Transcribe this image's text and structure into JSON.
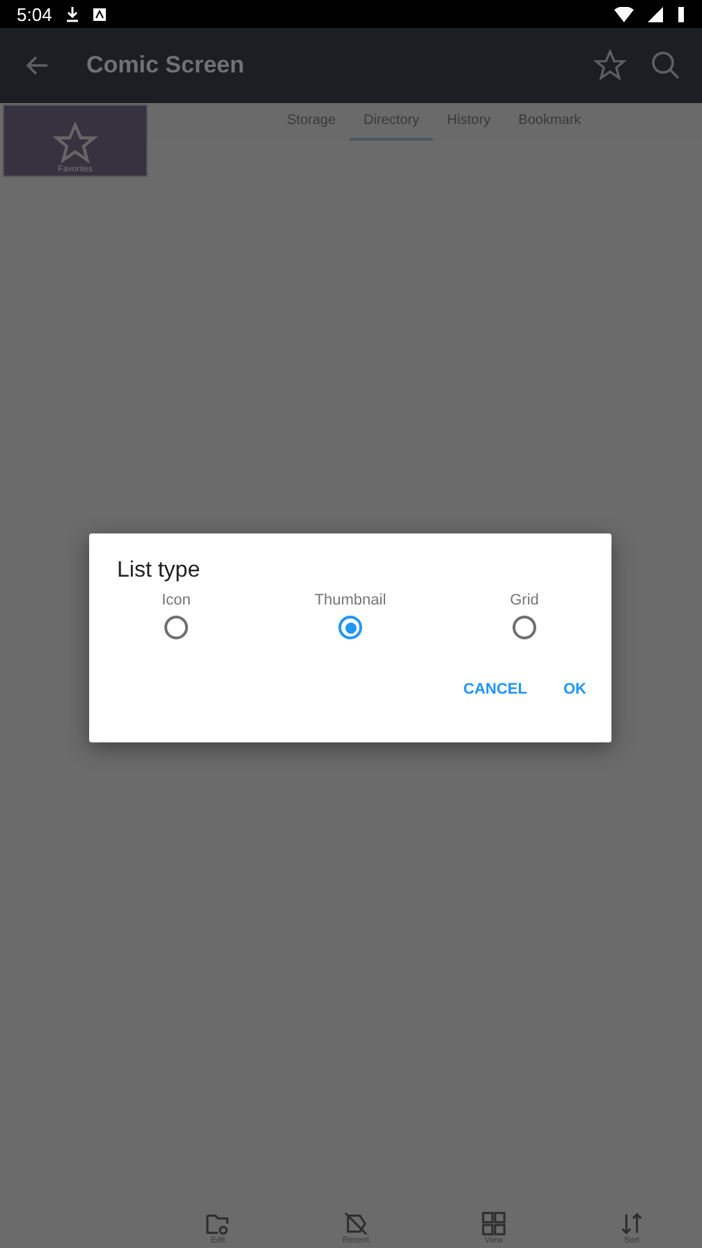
{
  "status_bar": {
    "time": "5:04"
  },
  "app_bar": {
    "title": "Comic Screen"
  },
  "tabs": [
    {
      "label": "Storage",
      "selected": false
    },
    {
      "label": "Directory",
      "selected": true
    },
    {
      "label": "History",
      "selected": false
    },
    {
      "label": "Bookmark",
      "selected": false
    }
  ],
  "favorites_tile": {
    "label": "Favorites"
  },
  "bottom_bar": [
    {
      "kind": "edit",
      "label": "Edit"
    },
    {
      "kind": "recent",
      "label": "Recent"
    },
    {
      "kind": "view",
      "label": "View"
    },
    {
      "kind": "sort",
      "label": "Sort"
    }
  ],
  "dialog": {
    "title": "List type",
    "options": [
      {
        "label": "Icon",
        "selected": false
      },
      {
        "label": "Thumbnail",
        "selected": true
      },
      {
        "label": "Grid",
        "selected": false
      }
    ],
    "buttons": [
      "CANCEL",
      "OK"
    ]
  }
}
